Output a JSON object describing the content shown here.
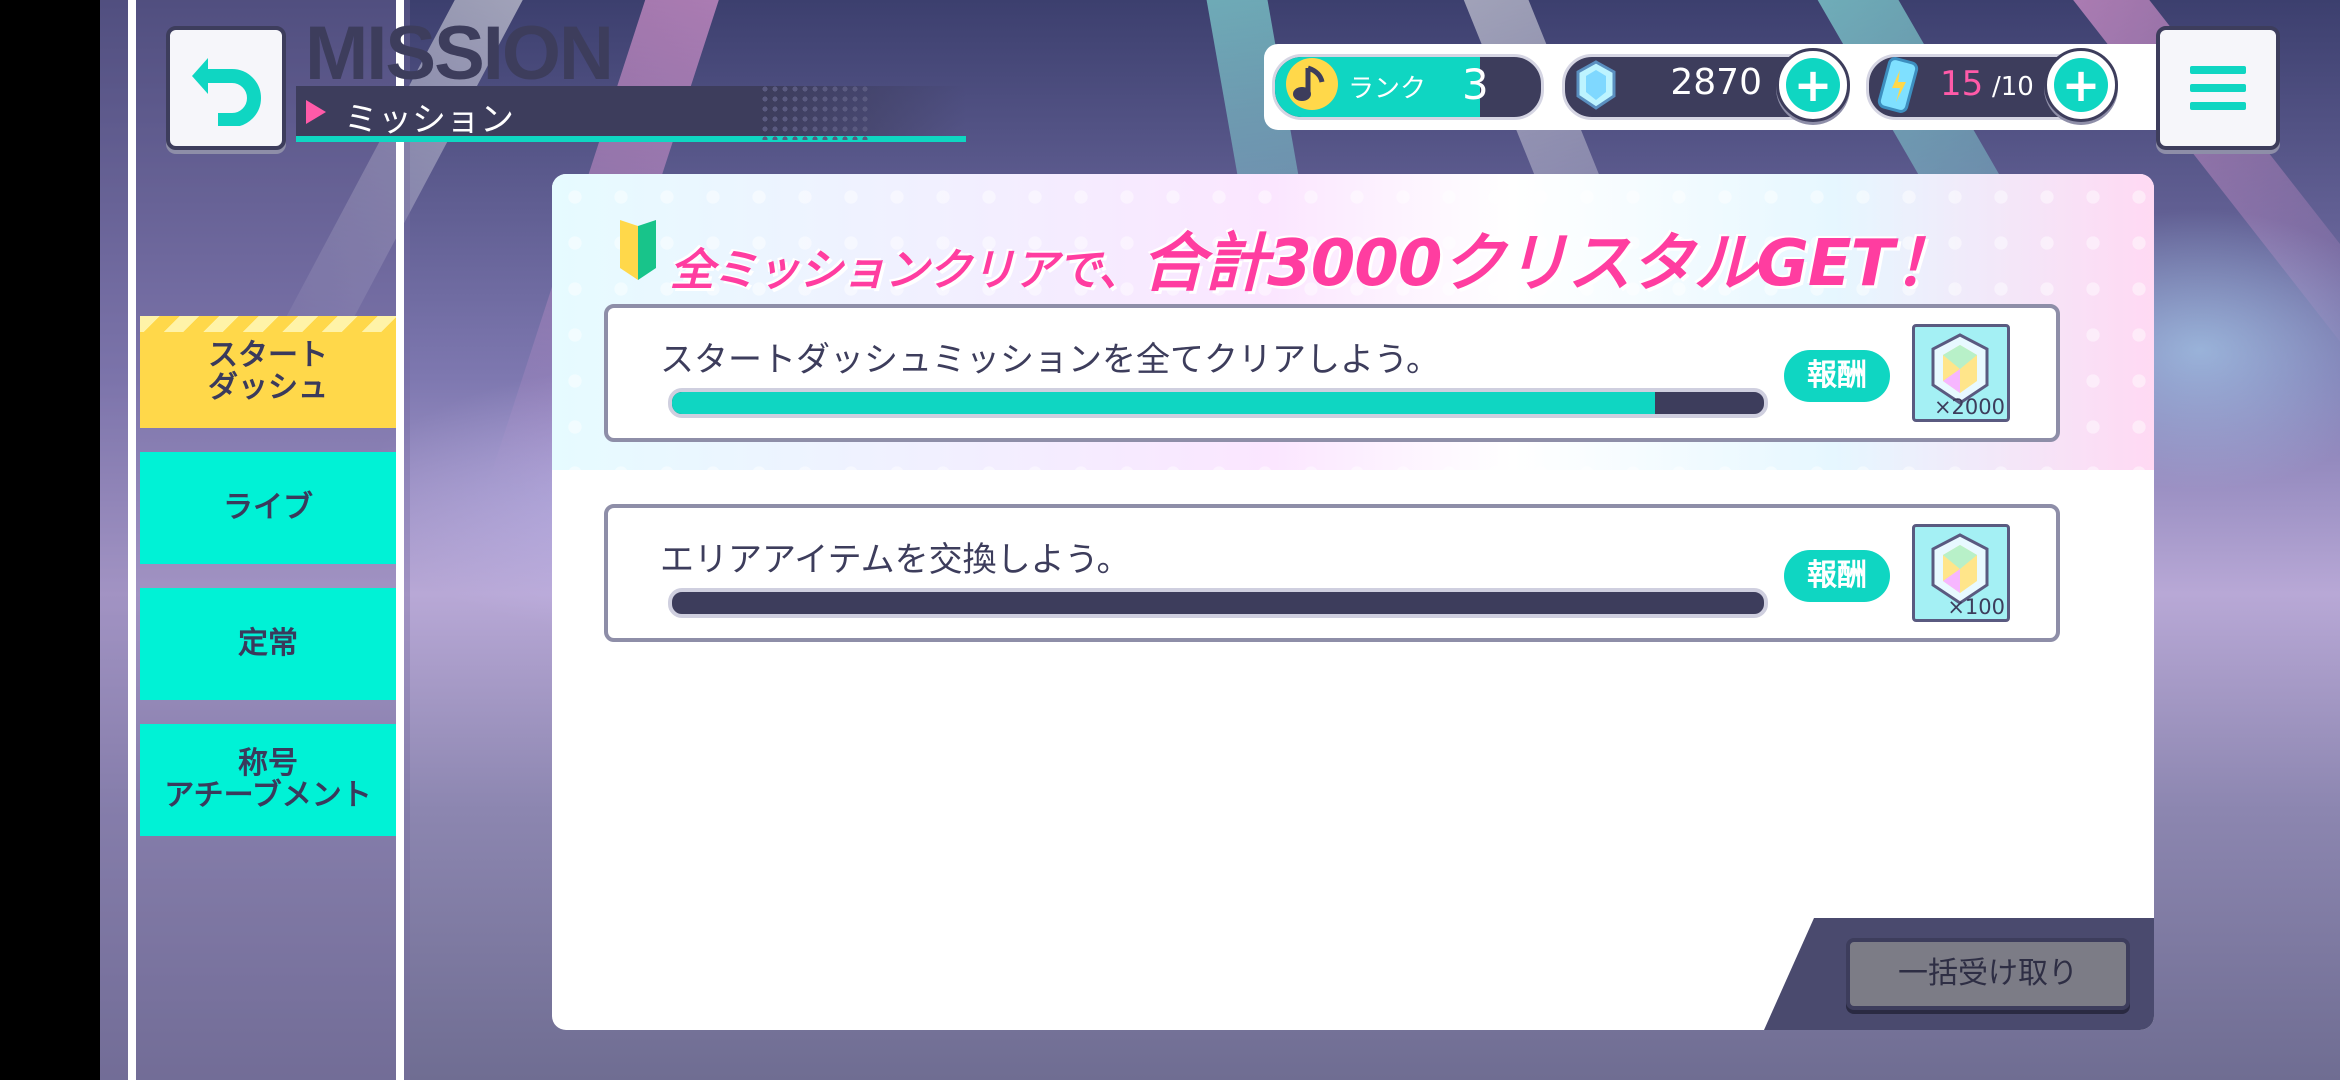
{
  "header": {
    "title_en": "MISSION",
    "title_jp": "ミッション"
  },
  "status": {
    "rank_label": "ランク",
    "rank_value": "3",
    "crystals": "2870",
    "energy_current": "15",
    "energy_max": "/10"
  },
  "sidebar": {
    "items": [
      {
        "label": "スタート\nダッシュ",
        "active": true
      },
      {
        "label": "ライブ",
        "active": false
      },
      {
        "label": "定常",
        "active": false
      },
      {
        "label": "称号\nアチーブメント",
        "active": false
      }
    ]
  },
  "banner": {
    "text_small": "全ミッションクリアで、",
    "text_big": "合計3000クリスタルGET！"
  },
  "missions": [
    {
      "text": "スタートダッシュミッションを全てクリアしよう。",
      "progress": 0.9,
      "reward_label": "報酬",
      "reward_qty": "×2000"
    },
    {
      "text": "エリアアイテムを交換しよう。",
      "progress": 0.0,
      "reward_label": "報酬",
      "reward_qty": "×100"
    }
  ],
  "bulk_receive_label": "一括受け取り",
  "colors": {
    "accent": "#0fd6c2",
    "navy": "#3d3d5c",
    "pink": "#ff3da0",
    "active_tab": "#ffd84a"
  },
  "icons": {
    "back": "back-arrow-icon",
    "menu": "hamburger-menu-icon",
    "rank": "music-note-icon",
    "crystal": "crystal-icon",
    "energy": "energy-drink-icon",
    "beginner": "beginner-mark-icon"
  }
}
